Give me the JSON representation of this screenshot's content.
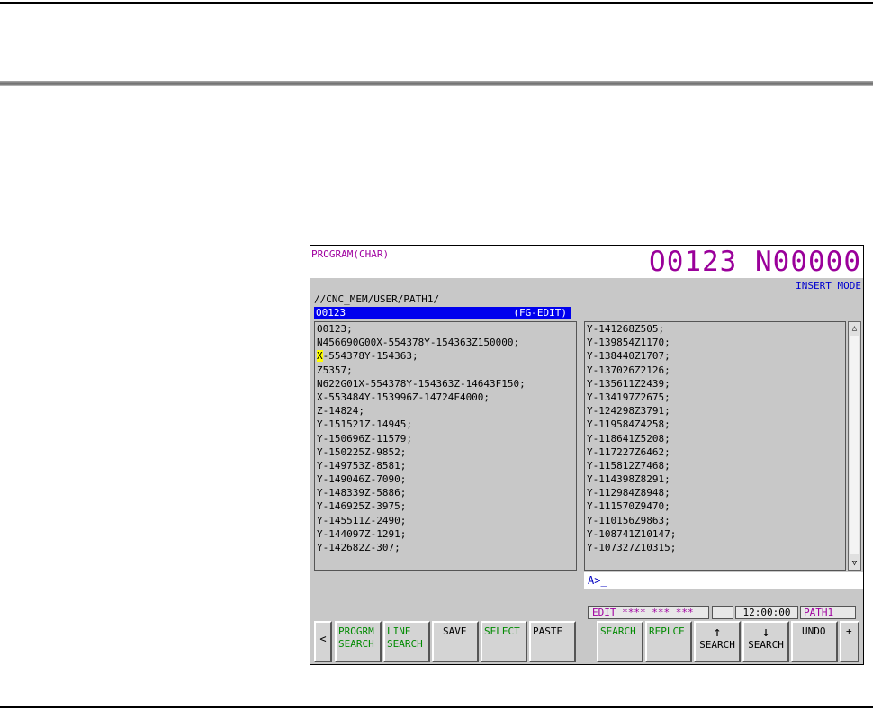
{
  "screen": {
    "title": "PROGRAM(CHAR)",
    "program_number": "O0123 N00000",
    "insert_mode": "INSERT MODE",
    "path": "//CNC_MEM/USER/PATH1/",
    "program_bar": {
      "name": "O0123",
      "mode": "(FG-EDIT)"
    }
  },
  "left_lines": [
    "O0123;",
    "N456690G00X-554378Y-154363Z150000;",
    "X-554378Y-154363;",
    "Z5357;",
    "N622G01X-554378Y-154363Z-14643F150;",
    "X-553484Y-153996Z-14724F4000;",
    "Z-14824;",
    "Y-151521Z-14945;",
    "Y-150696Z-11579;",
    "Y-150225Z-9852;",
    "Y-149753Z-8581;",
    "Y-149046Z-7090;",
    "Y-148339Z-5886;",
    "Y-146925Z-3975;",
    "Y-145511Z-2490;",
    "Y-144097Z-1291;",
    "Y-142682Z-307;"
  ],
  "cursor_char": "X",
  "cursor_rest": "-554378Y-154363;",
  "right_lines": [
    "Y-141268Z505;",
    "Y-139854Z1170;",
    "Y-138440Z1707;",
    "Y-137026Z2126;",
    "Y-135611Z2439;",
    "Y-134197Z2675;",
    "Y-124298Z3791;",
    "Y-119584Z4258;",
    "Y-118641Z5208;",
    "Y-117227Z6462;",
    "Y-115812Z7468;",
    "Y-114398Z8291;",
    "Y-112984Z8948;",
    "Y-111570Z9470;",
    "Y-110156Z9863;",
    "Y-108741Z10147;",
    "Y-107327Z10315;"
  ],
  "scroll": {
    "up": "△",
    "down": "▽"
  },
  "input_prompt": "A>_",
  "status": {
    "mode": "EDIT **** *** ***",
    "time": "12:00:00",
    "path": "PATH1"
  },
  "softkeys": {
    "prev": "<",
    "progrm_search_1": "PROGRM",
    "progrm_search_2": "SEARCH",
    "line_search_1": "LINE",
    "line_search_2": "SEARCH",
    "save": "SAVE",
    "select": "SELECT",
    "paste": "PASTE",
    "search": "SEARCH",
    "replace": "REPLCE",
    "search_up_1": "↑",
    "search_up_2": "SEARCH",
    "search_down_1": "↓",
    "search_down_2": "SEARCH",
    "undo": "UNDO",
    "next": "+"
  },
  "colors": {
    "title_magenta": "#a000a0",
    "highlight_blue": "#0000ee",
    "softkey_green": "#008a00",
    "cursor_yellow": "#ffff00"
  }
}
